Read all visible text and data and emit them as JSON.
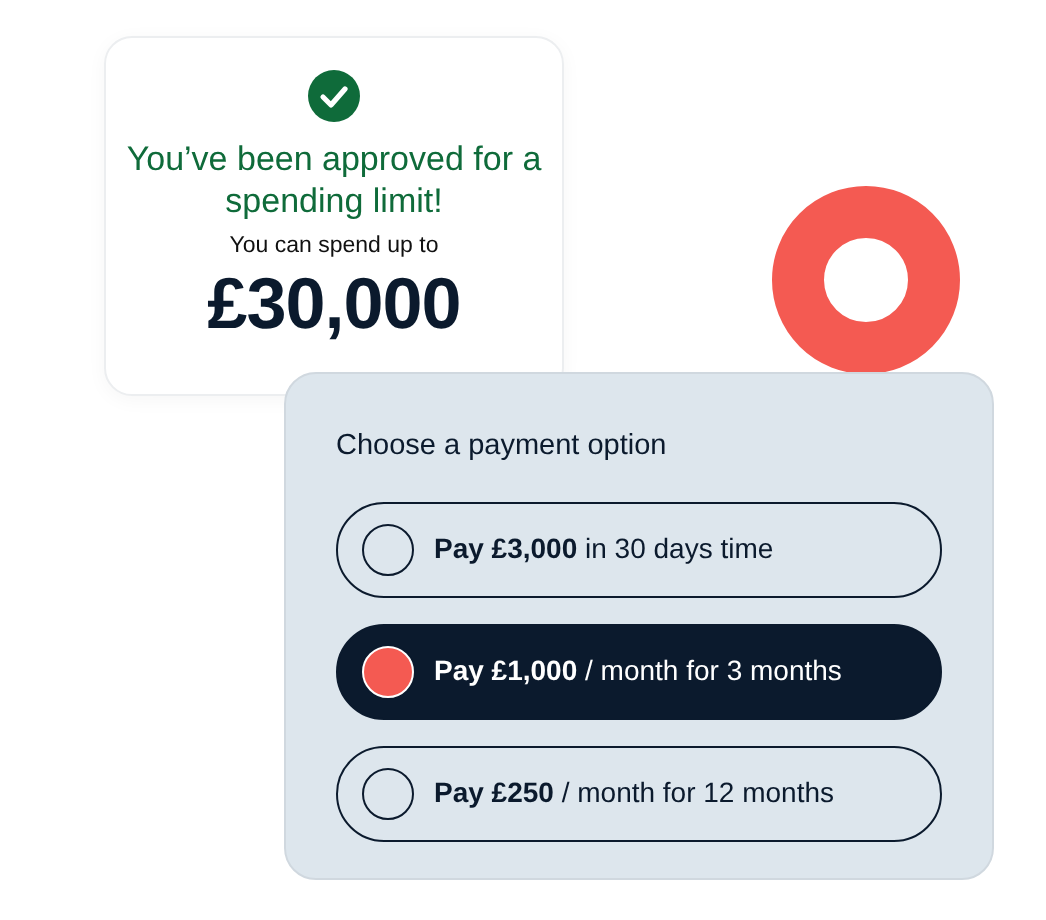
{
  "approval_card": {
    "title": "You’ve been approved for a spending limit!",
    "subtitle": "You can spend up to",
    "amount": "£30,000"
  },
  "payment_panel": {
    "heading": "Choose a payment option",
    "options": [
      {
        "label": "**Pay £3,000** in 30 days time",
        "selected": false
      },
      {
        "label": "**Pay £1,000** / month for 3 months",
        "selected": true
      },
      {
        "label": "**Pay £250** / month for 12 months",
        "selected": false
      }
    ]
  }
}
